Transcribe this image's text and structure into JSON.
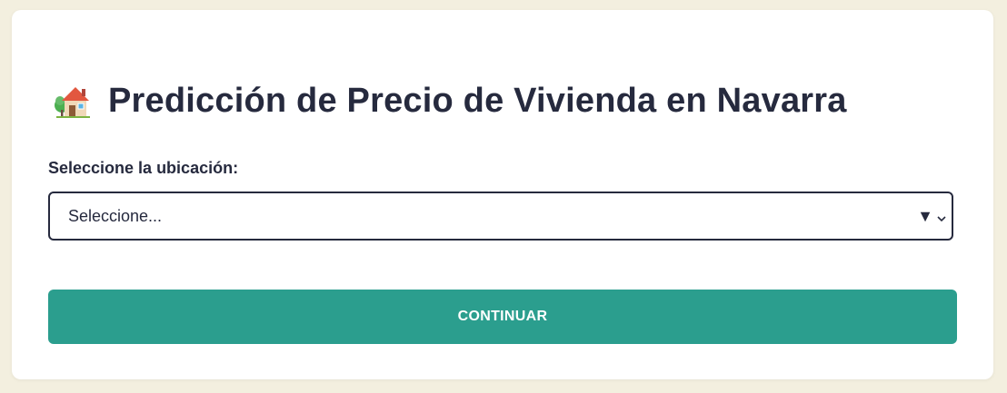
{
  "header": {
    "icon": "house-with-tree-icon",
    "title": "Predicción de Precio de Vivienda en Navarra"
  },
  "form": {
    "location_label": "Seleccione la ubicación:",
    "location_select": {
      "selected_value": "Seleccione...",
      "caret": "▼"
    },
    "continue_label": "CONTINUAR"
  },
  "colors": {
    "background": "#f3efdf",
    "card": "#ffffff",
    "text": "#262a3e",
    "button": "#2b9e8e",
    "button_text": "#ffffff"
  }
}
